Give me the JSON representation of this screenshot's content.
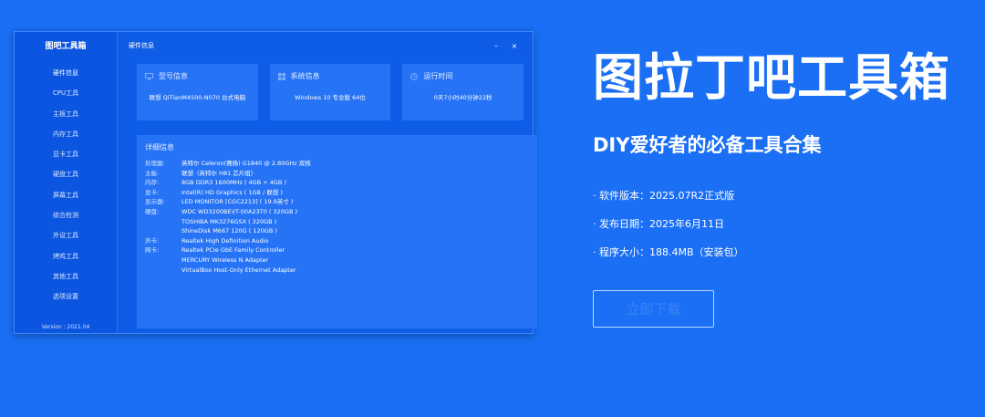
{
  "app": {
    "title": "图吧工具箱",
    "version": "Version : 2021.04",
    "nav": [
      "硬件信息",
      "CPU工具",
      "主板工具",
      "内存工具",
      "显卡工具",
      "硬盘工具",
      "屏幕工具",
      "综合检测",
      "外设工具",
      "烤鸡工具",
      "其他工具",
      "选项设置"
    ],
    "window_title": "硬件信息",
    "minimize": "–",
    "close": "×",
    "cards": [
      {
        "icon": "monitor-icon",
        "label": "型号信息",
        "value": "联想 QiTianM4500-N070 台式电脑"
      },
      {
        "icon": "windows-icon",
        "label": "系统信息",
        "value": "Windows 10 专业版 64位"
      },
      {
        "icon": "clock-icon",
        "label": "运行时间",
        "value": "0天7小时40分钟22秒"
      }
    ],
    "details": {
      "title": "详细信息",
      "rows": [
        {
          "k": "处理器:",
          "v": "英特尔 Celeron(赛扬) G1840 @ 2.80GHz 双核"
        },
        {
          "k": "主板:",
          "v": "联想（英特尔 H81 芯片组）"
        },
        {
          "k": "内存:",
          "v": "8GB DDR3 1600MHz ( 4GB + 4GB )"
        },
        {
          "k": "显卡:",
          "v": "Intel(R) HD Graphics ( 1GB / 联想 )"
        },
        {
          "k": "显示器:",
          "v": "LED MONITOR [CGC2213] ( 19.9英寸 )"
        },
        {
          "k": "硬盘:",
          "v": "WDC WD3200BEVT-00A23T0 ( 320GB )"
        },
        {
          "k": "",
          "v": "TOSHIBA MK3276GSX ( 320GB )"
        },
        {
          "k": "",
          "v": "ShineDisk M667 120G ( 120GB )"
        },
        {
          "k": "声卡:",
          "v": "Realtek High Definition Audio"
        },
        {
          "k": "网卡:",
          "v": "Realtek PCIe GbE Family Controller"
        },
        {
          "k": "",
          "v": "MERCURY Wireless N Adapter"
        },
        {
          "k": "",
          "v": "VirtualBox Host-Only Ethernet Adapter"
        }
      ]
    }
  },
  "promo": {
    "title": "图拉丁吧工具箱",
    "subtitle": "DIY爱好者的必备工具合集",
    "info": [
      "· 软件版本：2025.07R2正式版",
      "· 发布日期：2025年6月11日",
      "· 程序大小：188.4MB（安装包）"
    ],
    "download_label": "立即下载"
  },
  "colors": {
    "background": "#1a6ff5",
    "sidebar": "#0b55e0",
    "panel": "#2673f6"
  }
}
